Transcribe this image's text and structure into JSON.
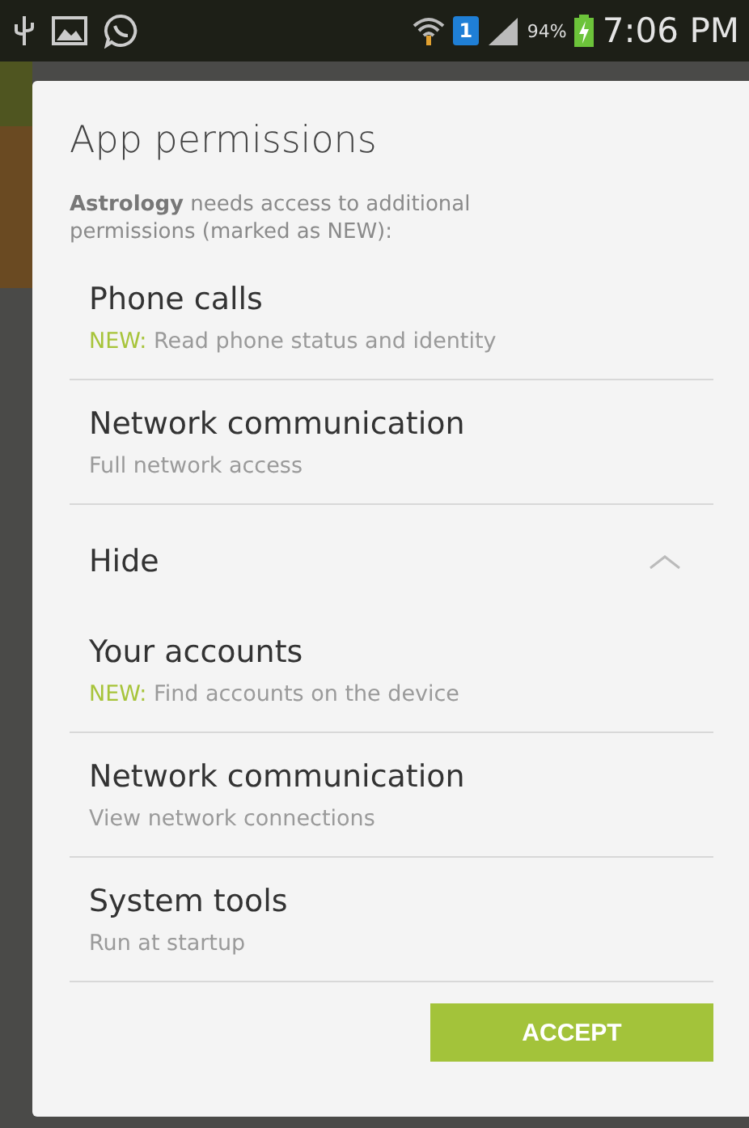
{
  "status_bar": {
    "sim_slot": "1",
    "battery_percent": "94%",
    "time": "7:06 PM"
  },
  "dialog": {
    "title": "App permissions",
    "intro": "**Astrology** needs access to additional permissions (marked as NEW):",
    "items": [
      {
        "kind": "permission",
        "title": "Phone calls",
        "tag": "NEW:",
        "description": "Read phone status and identity"
      },
      {
        "kind": "permission",
        "title": "Network communication",
        "description": "Full network access"
      },
      {
        "kind": "expander",
        "title": "Hide",
        "expanded": true
      },
      {
        "kind": "permission",
        "title": "Your accounts",
        "tag": "NEW:",
        "description": "Find accounts on the device"
      },
      {
        "kind": "permission",
        "title": "Network communication",
        "description": "View network connections"
      },
      {
        "kind": "permission",
        "title": "System tools",
        "description": "Run at startup"
      }
    ],
    "button": "ACCEPT"
  }
}
